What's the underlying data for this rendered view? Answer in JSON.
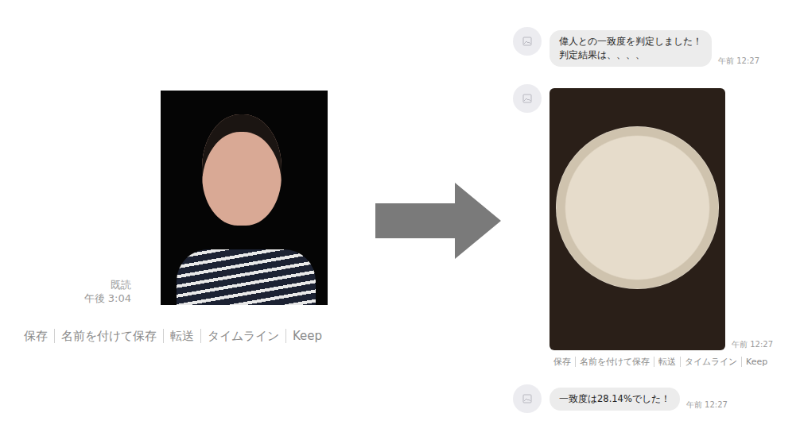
{
  "left": {
    "read": "既読",
    "time": "午後 3:04",
    "actions": [
      "保存",
      "名前を付けて保存",
      "転送",
      "タイムライン",
      "Keep"
    ]
  },
  "right": {
    "messages": [
      {
        "kind": "text",
        "lines": [
          "偉人との一致度を判定しました！",
          "判定結果は、、、、"
        ],
        "time": "午前 12:27"
      },
      {
        "kind": "image",
        "time": "午前 12:27",
        "actions": [
          "保存",
          "名前を付けて保存",
          "転送",
          "タイムライン",
          "Keep"
        ]
      },
      {
        "kind": "text",
        "lines": [
          "一致度は28.14%でした！"
        ],
        "time": "午前 12:27"
      }
    ]
  }
}
